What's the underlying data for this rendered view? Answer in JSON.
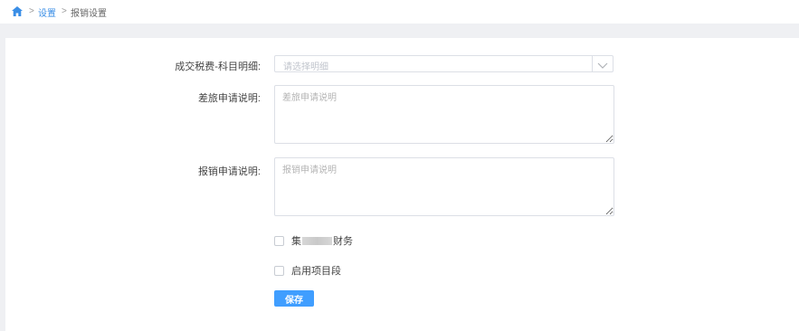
{
  "breadcrumb": {
    "home_icon": "home-icon",
    "separator": ">",
    "settings_link": "设置",
    "current": "报销设置"
  },
  "form": {
    "tax_detail": {
      "label": "成交税费-科目明细:",
      "placeholder": "请选择明细",
      "arrow_icon": "chevron-down-icon"
    },
    "travel_desc": {
      "label": "差旅申请说明:",
      "placeholder": "差旅申请说明"
    },
    "reimburse_desc": {
      "label": "报销申请说明:",
      "placeholder": "报销申请说明"
    },
    "checkbox_group_finance": {
      "label_prefix": "集",
      "label_suffix": "财务",
      "checked": false
    },
    "checkbox_project_segment": {
      "label": "启用项目段",
      "checked": false
    },
    "save_label": "保存"
  },
  "colors": {
    "accent": "#409eff",
    "link": "#3a8ee6",
    "page_bg": "#eff0f3",
    "border": "#dcdfe6"
  }
}
